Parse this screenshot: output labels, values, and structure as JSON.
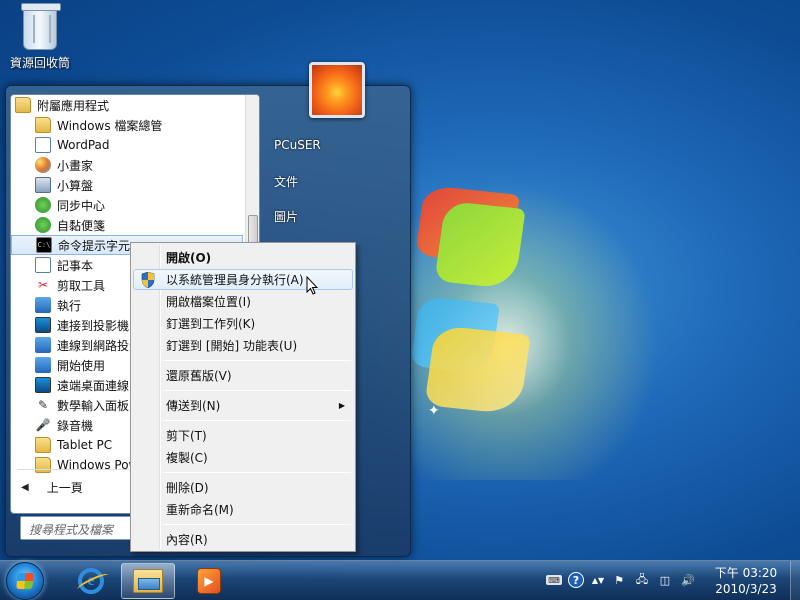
{
  "desktop": {
    "recycle_bin_label": "資源回收筒"
  },
  "start_menu": {
    "programs": [
      {
        "label": "附屬應用程式",
        "icon": "folder-icon",
        "type": "folder"
      },
      {
        "label": "Windows 檔案總管",
        "icon": "explorer-icon"
      },
      {
        "label": "WordPad",
        "icon": "wordpad-icon"
      },
      {
        "label": "小畫家",
        "icon": "paint-icon"
      },
      {
        "label": "小算盤",
        "icon": "calculator-icon"
      },
      {
        "label": "同步中心",
        "icon": "sync-center-icon"
      },
      {
        "label": "自黏便箋",
        "icon": "sticky-notes-icon"
      },
      {
        "label": "命令提示字元",
        "icon": "command-prompt-icon",
        "selected": true
      },
      {
        "label": "記事本",
        "icon": "notepad-icon"
      },
      {
        "label": "剪取工具",
        "icon": "snipping-tool-icon"
      },
      {
        "label": "執行",
        "icon": "run-icon"
      },
      {
        "label": "連接到投影機",
        "icon": "projector-icon"
      },
      {
        "label": "連線到網路投影",
        "icon": "network-projector-icon"
      },
      {
        "label": "開始使用",
        "icon": "getting-started-icon"
      },
      {
        "label": "遠端桌面連線",
        "icon": "remote-desktop-icon"
      },
      {
        "label": "數學輸入面板",
        "icon": "math-input-icon"
      },
      {
        "label": "錄音機",
        "icon": "sound-recorder-icon"
      },
      {
        "label": "Tablet PC",
        "icon": "folder-icon"
      },
      {
        "label": "Windows Pow",
        "icon": "folder-icon"
      }
    ],
    "back_label": "上一頁",
    "search_placeholder": "搜尋程式及檔案",
    "right_links": [
      "PCuSER",
      "文件",
      "圖片"
    ]
  },
  "context_menu": {
    "items": [
      {
        "label": "開啟(O)",
        "bold": true
      },
      {
        "label": "以系統管理員身分執行(A)",
        "icon": "uac-shield-icon",
        "hover": true
      },
      {
        "label": "開啟檔案位置(I)"
      },
      {
        "label": "釘選到工作列(K)"
      },
      {
        "label": "釘選到 [開始] 功能表(U)"
      },
      {
        "separator": true
      },
      {
        "label": "還原舊版(V)"
      },
      {
        "separator": true
      },
      {
        "label": "傳送到(N)",
        "submenu": true
      },
      {
        "separator": true
      },
      {
        "label": "剪下(T)"
      },
      {
        "label": "複製(C)"
      },
      {
        "separator": true
      },
      {
        "label": "刪除(D)"
      },
      {
        "label": "重新命名(M)"
      },
      {
        "separator": true
      },
      {
        "label": "內容(R)"
      }
    ],
    "submenu_glyph": "▶"
  },
  "taskbar": {
    "clock_period": "下午 03:20",
    "clock_date": "2010/3/23"
  }
}
